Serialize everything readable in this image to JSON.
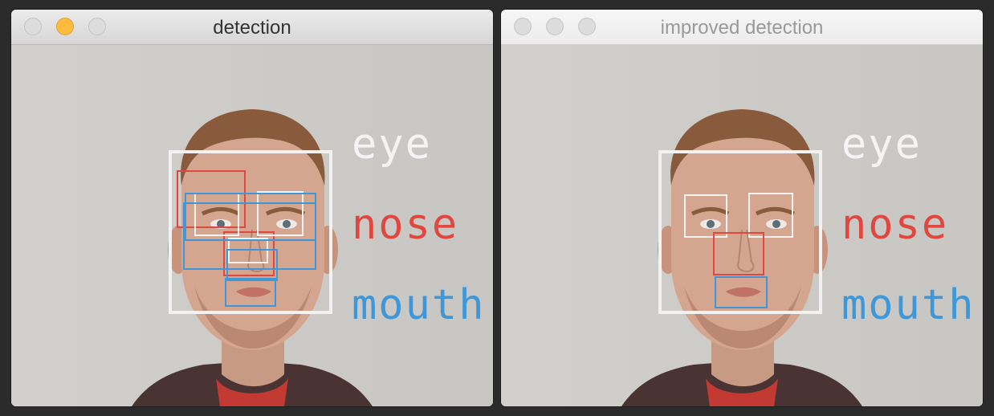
{
  "windows": [
    {
      "title": "detection",
      "active": true,
      "legend": {
        "eye": "eye",
        "nose": "nose",
        "mouth": "mouth"
      }
    },
    {
      "title": "improved detection",
      "active": false,
      "legend": {
        "eye": "eye",
        "nose": "nose",
        "mouth": "mouth"
      }
    }
  ],
  "colors": {
    "eye": "#f2f2f2",
    "nose": "#e0473f",
    "mouth": "#3d97d9",
    "minimize_active": "#fdbc40"
  }
}
